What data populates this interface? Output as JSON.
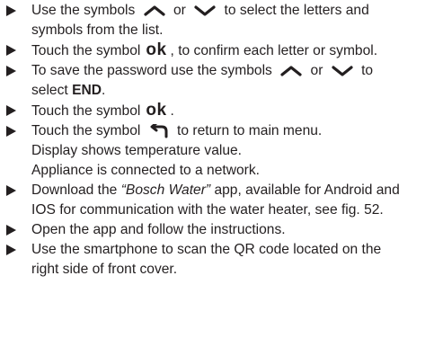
{
  "icons": {
    "up": "chevron-up-icon",
    "down": "chevron-down-icon",
    "back": "return-arrow-icon",
    "bullet": "triangle-right-icon"
  },
  "ok_symbol": "ok",
  "lines": {
    "l1a": "Use the symbols",
    "l1b": "or",
    "l1c": "to select the letters and",
    "l1d": "symbols from the list.",
    "l2a": "Touch the symbol",
    "l2b": ", to confirm each letter or symbol.",
    "l3a": "To save the password use the symbols",
    "l3b": "or",
    "l3c": "to",
    "l3d": "select",
    "l3e": "END",
    "l3f": ".",
    "l4a": "Touch the symbol",
    "l4b": ".",
    "l5a": "Touch the symbol",
    "l5b": "to return to main menu.",
    "p1": "Display shows temperature value.",
    "p2": "Appliance is connected to a network.",
    "l6a": "Download the",
    "l6b": "“Bosch Water”",
    "l6c": "app, available for Android and",
    "l6d": "IOS for communication with the water heater, see fig. 52.",
    "l7": "Open the app and follow the instructions.",
    "l8a": "Use the smartphone to scan the QR code located on the",
    "l8b": "right side of front cover."
  }
}
